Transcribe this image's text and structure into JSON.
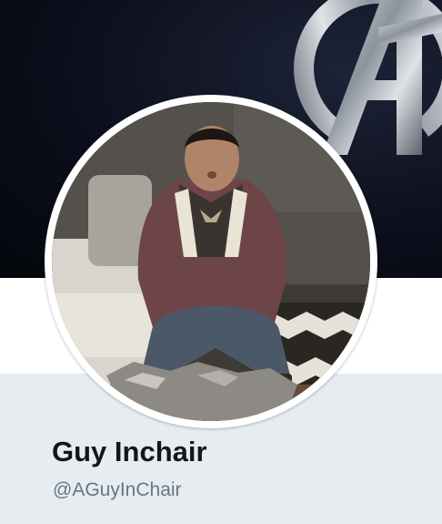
{
  "profile": {
    "display_name": "Guy Inchair",
    "handle": "@AGuyInChair"
  },
  "icons": {
    "banner_logo": "avengers-a-logo-icon"
  },
  "colors": {
    "banner_background": "#0c0f1c",
    "info_panel_background": "#e6ecf0",
    "name_text": "#14171a",
    "handle_text": "#657786"
  }
}
